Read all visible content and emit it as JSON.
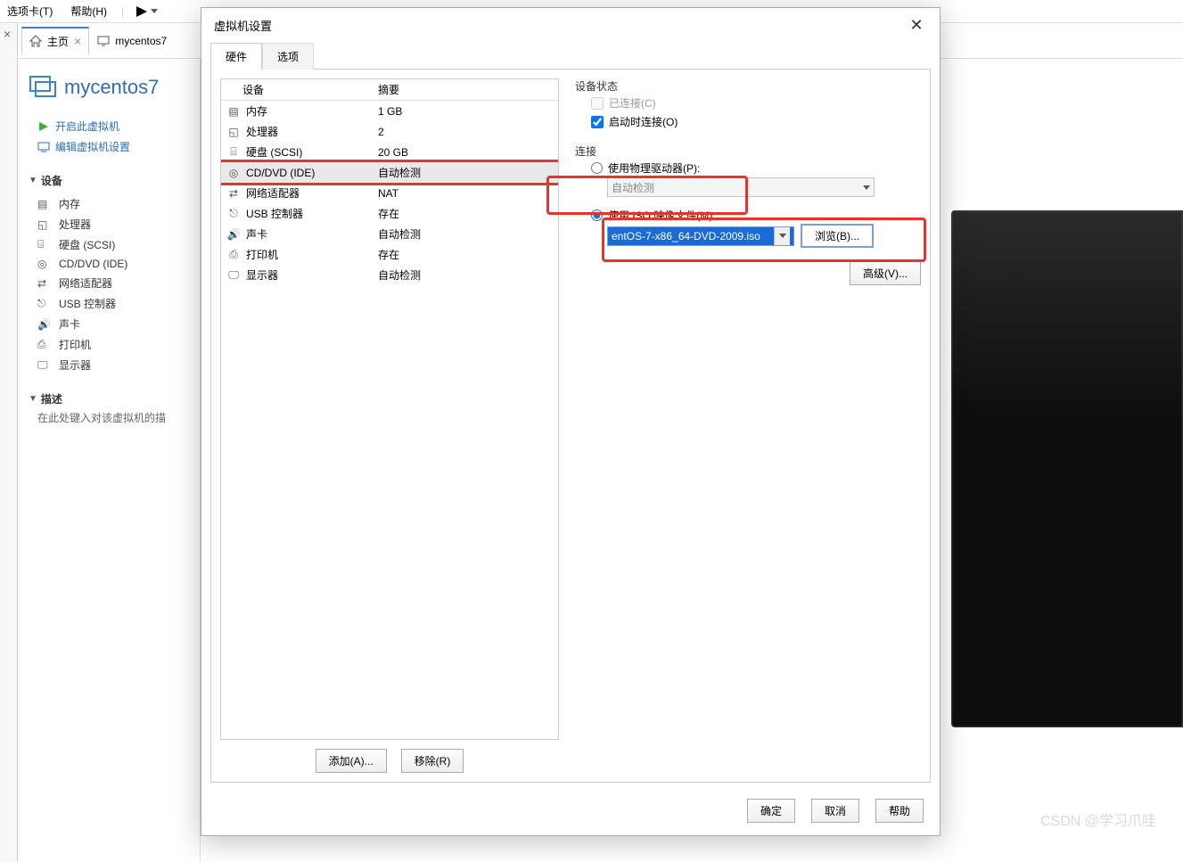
{
  "menubar": {
    "tabs_menu": "选项卡(T)",
    "help": "帮助(H)"
  },
  "tabs": {
    "home": "主页",
    "vm": "mycentos7"
  },
  "vm": {
    "title": "mycentos7"
  },
  "actions": {
    "power_on": "开启此虚拟机",
    "edit_settings": "编辑虚拟机设置"
  },
  "sections": {
    "devices": "设备",
    "description": "描述"
  },
  "devices": {
    "memory": "内存",
    "cpu": "处理器",
    "disk": "硬盘 (SCSI)",
    "cddvd": "CD/DVD (IDE)",
    "net": "网络适配器",
    "usb": "USB 控制器",
    "sound": "声卡",
    "printer": "打印机",
    "display": "显示器"
  },
  "desc_hint": "在此处键入对该虚拟机的描",
  "dialog": {
    "title": "虚拟机设置",
    "tab_hw": "硬件",
    "tab_opt": "选项",
    "col_device": "设备",
    "col_summary": "摘要",
    "rows": {
      "memory_v": "1 GB",
      "cpu_v": "2",
      "disk_v": "20 GB",
      "cddvd_v": "自动检测",
      "net_v": "NAT",
      "usb_v": "存在",
      "sound_v": "自动检测",
      "printer_v": "存在",
      "display_v": "自动检测"
    },
    "add": "添加(A)...",
    "remove": "移除(R)",
    "status_label": "设备状态",
    "connected": "已连接(C)",
    "connect_on": "启动时连接(O)",
    "connection_label": "连接",
    "use_physical": "使用物理驱动器(P):",
    "auto_detect": "自动检测",
    "use_iso": "使用 ISO 映像文件(M):",
    "iso_value": "entOS-7-x86_64-DVD-2009.iso",
    "browse": "浏览(B)...",
    "advanced": "高级(V)...",
    "ok": "确定",
    "cancel": "取消",
    "help": "帮助"
  },
  "watermark": "CSDN @学习爪哇"
}
